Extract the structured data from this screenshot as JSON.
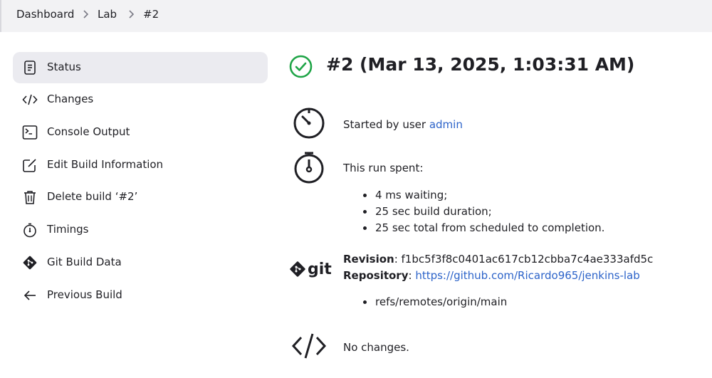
{
  "breadcrumb": {
    "items": [
      "Dashboard",
      "Lab",
      "#2"
    ]
  },
  "sidebar": {
    "items": [
      {
        "label": "Status",
        "icon": "document-icon",
        "active": true
      },
      {
        "label": "Changes",
        "icon": "code-icon"
      },
      {
        "label": "Console Output",
        "icon": "terminal-icon"
      },
      {
        "label": "Edit Build Information",
        "icon": "edit-icon"
      },
      {
        "label": "Delete build ‘#2’",
        "icon": "trash-icon"
      },
      {
        "label": "Timings",
        "icon": "stopwatch-icon"
      },
      {
        "label": "Git Build Data",
        "icon": "git-icon"
      },
      {
        "label": "Previous Build",
        "icon": "arrow-left-icon"
      }
    ]
  },
  "build": {
    "title": "#2 (Mar 13, 2025, 1:03:31 AM)",
    "status_icon": "success-check-icon",
    "status_color": "#1ea446",
    "started_prefix": "Started by user ",
    "started_user": "admin",
    "run_spent_label": "This run spent:",
    "timings": [
      "4 ms waiting;",
      "25 sec build duration;",
      "25 sec total from scheduled to completion."
    ],
    "git_logo_text": "git",
    "revision_label": "Revision",
    "revision_value": ": f1bc5f3f8c0401ac617cb12cbba7c4ae333afd5c",
    "repository_label": "Repository",
    "repository_sep": ": ",
    "repository_url": "https://github.com/Ricardo965/jenkins-lab",
    "refs": [
      "refs/remotes/origin/main"
    ],
    "changes_text": "No changes."
  },
  "colors": {
    "link": "#2c63c9",
    "accent_active": "#ebebf0"
  }
}
